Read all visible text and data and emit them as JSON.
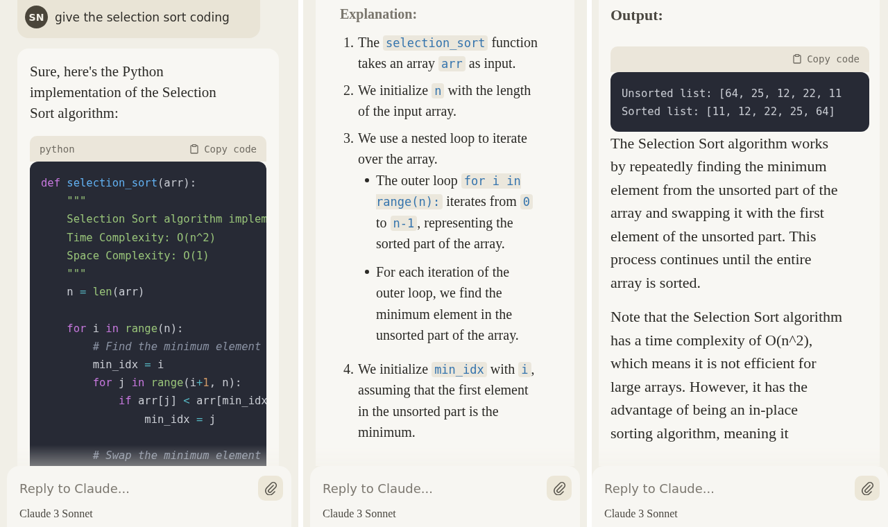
{
  "panels": [
    {
      "user_message": {
        "avatar": "SN",
        "text": "give the selection sort coding"
      },
      "blocks": [
        {
          "kind": "paragraph",
          "segments": [
            {
              "kind": "text",
              "text": "Sure, here's the Python implementation of the Selection Sort algorithm:"
            }
          ]
        },
        {
          "kind": "code",
          "language": "python",
          "copy_label": "Copy code",
          "lines": [
            {
              "kind": "code",
              "tokens": [
                {
                  "kind": "keyword",
                  "text": "def"
                },
                {
                  "kind": "function",
                  "text": " selection_sort"
                },
                {
                  "kind": "plain",
                  "text": "(arr):"
                }
              ]
            },
            {
              "kind": "code",
              "tokens": [
                {
                  "kind": "string",
                  "text": "    \"\"\""
                }
              ]
            },
            {
              "kind": "code",
              "tokens": [
                {
                  "kind": "string",
                  "text": "    Selection Sort algorithm implem"
                }
              ]
            },
            {
              "kind": "code",
              "tokens": [
                {
                  "kind": "string",
                  "text": "    Time Complexity: O(n^2)"
                }
              ]
            },
            {
              "kind": "code",
              "tokens": [
                {
                  "kind": "string",
                  "text": "    Space Complexity: O(1)"
                }
              ]
            },
            {
              "kind": "code",
              "tokens": [
                {
                  "kind": "string",
                  "text": "    \"\"\""
                }
              ]
            },
            {
              "kind": "code",
              "tokens": [
                {
                  "kind": "plain",
                  "text": "    n "
                },
                {
                  "kind": "operator",
                  "text": "="
                },
                {
                  "kind": "builtin",
                  "text": " len"
                },
                {
                  "kind": "plain",
                  "text": "(arr)"
                }
              ]
            },
            {
              "kind": "blank"
            },
            {
              "kind": "code",
              "tokens": [
                {
                  "kind": "keyword",
                  "text": "    for"
                },
                {
                  "kind": "plain",
                  "text": " i "
                },
                {
                  "kind": "keyword",
                  "text": "in"
                },
                {
                  "kind": "builtin",
                  "text": " range"
                },
                {
                  "kind": "plain",
                  "text": "(n):"
                }
              ]
            },
            {
              "kind": "code",
              "tokens": [
                {
                  "kind": "comment",
                  "text": "        # Find the minimum element"
                }
              ]
            },
            {
              "kind": "code",
              "tokens": [
                {
                  "kind": "plain",
                  "text": "        min_idx "
                },
                {
                  "kind": "operator",
                  "text": "="
                },
                {
                  "kind": "plain",
                  "text": " i"
                }
              ]
            },
            {
              "kind": "code",
              "tokens": [
                {
                  "kind": "keyword",
                  "text": "        for"
                },
                {
                  "kind": "plain",
                  "text": " j "
                },
                {
                  "kind": "keyword",
                  "text": "in"
                },
                {
                  "kind": "builtin",
                  "text": " range"
                },
                {
                  "kind": "plain",
                  "text": "(i"
                },
                {
                  "kind": "operator",
                  "text": "+"
                },
                {
                  "kind": "number",
                  "text": "1"
                },
                {
                  "kind": "plain",
                  "text": ", n):"
                }
              ]
            },
            {
              "kind": "code",
              "tokens": [
                {
                  "kind": "keyword",
                  "text": "            if"
                },
                {
                  "kind": "plain",
                  "text": " arr[j] "
                },
                {
                  "kind": "operator",
                  "text": "<"
                },
                {
                  "kind": "plain",
                  "text": " arr[min_idx"
                }
              ]
            },
            {
              "kind": "code",
              "tokens": [
                {
                  "kind": "plain",
                  "text": "                min_idx "
                },
                {
                  "kind": "operator",
                  "text": "="
                },
                {
                  "kind": "plain",
                  "text": " j"
                }
              ]
            },
            {
              "kind": "blank"
            },
            {
              "kind": "code",
              "tokens": [
                {
                  "kind": "comment",
                  "text": "        # Swap the minimum element"
                }
              ]
            }
          ]
        }
      ],
      "composer": {
        "placeholder": "Reply to Claude...",
        "model": "Claude 3 Sonnet"
      }
    },
    {
      "blocks": [
        {
          "kind": "heading",
          "text": "Explanation:"
        },
        {
          "kind": "list",
          "items": [
            {
              "number": "1.",
              "segments": [
                {
                  "kind": "text",
                  "text": "The "
                },
                {
                  "kind": "code",
                  "text": "selection_sort"
                },
                {
                  "kind": "text",
                  "text": " function takes an array "
                },
                {
                  "kind": "code",
                  "text": "arr"
                },
                {
                  "kind": "text",
                  "text": " as input."
                }
              ]
            },
            {
              "number": "2.",
              "segments": [
                {
                  "kind": "text",
                  "text": "We initialize "
                },
                {
                  "kind": "code",
                  "text": "n"
                },
                {
                  "kind": "text",
                  "text": " with the length of the input array."
                }
              ]
            },
            {
              "number": "3.",
              "segments": [
                {
                  "kind": "text",
                  "text": "We use a nested loop to iterate over the array."
                }
              ],
              "children": [
                {
                  "segments": [
                    {
                      "kind": "text",
                      "text": "The outer loop "
                    },
                    {
                      "kind": "code",
                      "text": "for i in range(n):"
                    },
                    {
                      "kind": "text",
                      "text": " iterates from "
                    },
                    {
                      "kind": "code",
                      "text": "0"
                    },
                    {
                      "kind": "text",
                      "text": " to "
                    },
                    {
                      "kind": "code",
                      "text": "n-1"
                    },
                    {
                      "kind": "text",
                      "text": ", representing the sorted part of the array."
                    }
                  ]
                },
                {
                  "segments": [
                    {
                      "kind": "text",
                      "text": "For each iteration of the outer loop, we find the minimum element in the unsorted part of the array."
                    }
                  ]
                }
              ]
            },
            {
              "number": "4.",
              "segments": [
                {
                  "kind": "text",
                  "text": "We initialize "
                },
                {
                  "kind": "code",
                  "text": "min_idx"
                },
                {
                  "kind": "text",
                  "text": " with "
                },
                {
                  "kind": "code",
                  "text": "i"
                },
                {
                  "kind": "text",
                  "text": ", assuming that the first element in the unsorted part is the minimum."
                }
              ]
            }
          ]
        }
      ],
      "composer": {
        "placeholder": "Reply to Claude...",
        "model": "Claude 3 Sonnet"
      }
    },
    {
      "blocks": [
        {
          "kind": "heading",
          "text": "Output:"
        },
        {
          "kind": "code",
          "copy_label": "Copy code",
          "lines": [
            {
              "kind": "code",
              "tokens": [
                {
                  "kind": "plain",
                  "text": "Unsorted list: [64, 25, 12, 22, 11"
                }
              ]
            },
            {
              "kind": "code",
              "tokens": [
                {
                  "kind": "plain",
                  "text": "Sorted list: [11, 12, 22, 25, 64]"
                }
              ]
            }
          ]
        },
        {
          "kind": "paragraph",
          "segments": [
            {
              "kind": "text",
              "text": "The Selection Sort algorithm works by repeatedly finding the minimum element from the unsorted part of the array and swapping it with the first element of the unsorted part. This process continues until the entire array is sorted."
            }
          ]
        },
        {
          "kind": "paragraph",
          "segments": [
            {
              "kind": "text",
              "text": "Note that the Selection Sort algorithm has a time complexity of O(n^2), which means it is not efficient for large arrays. However, it has the advantage of being an in-place sorting algorithm, meaning it"
            }
          ]
        }
      ],
      "composer": {
        "placeholder": "Reply to Claude...",
        "model": "Claude 3 Sonnet"
      }
    }
  ]
}
